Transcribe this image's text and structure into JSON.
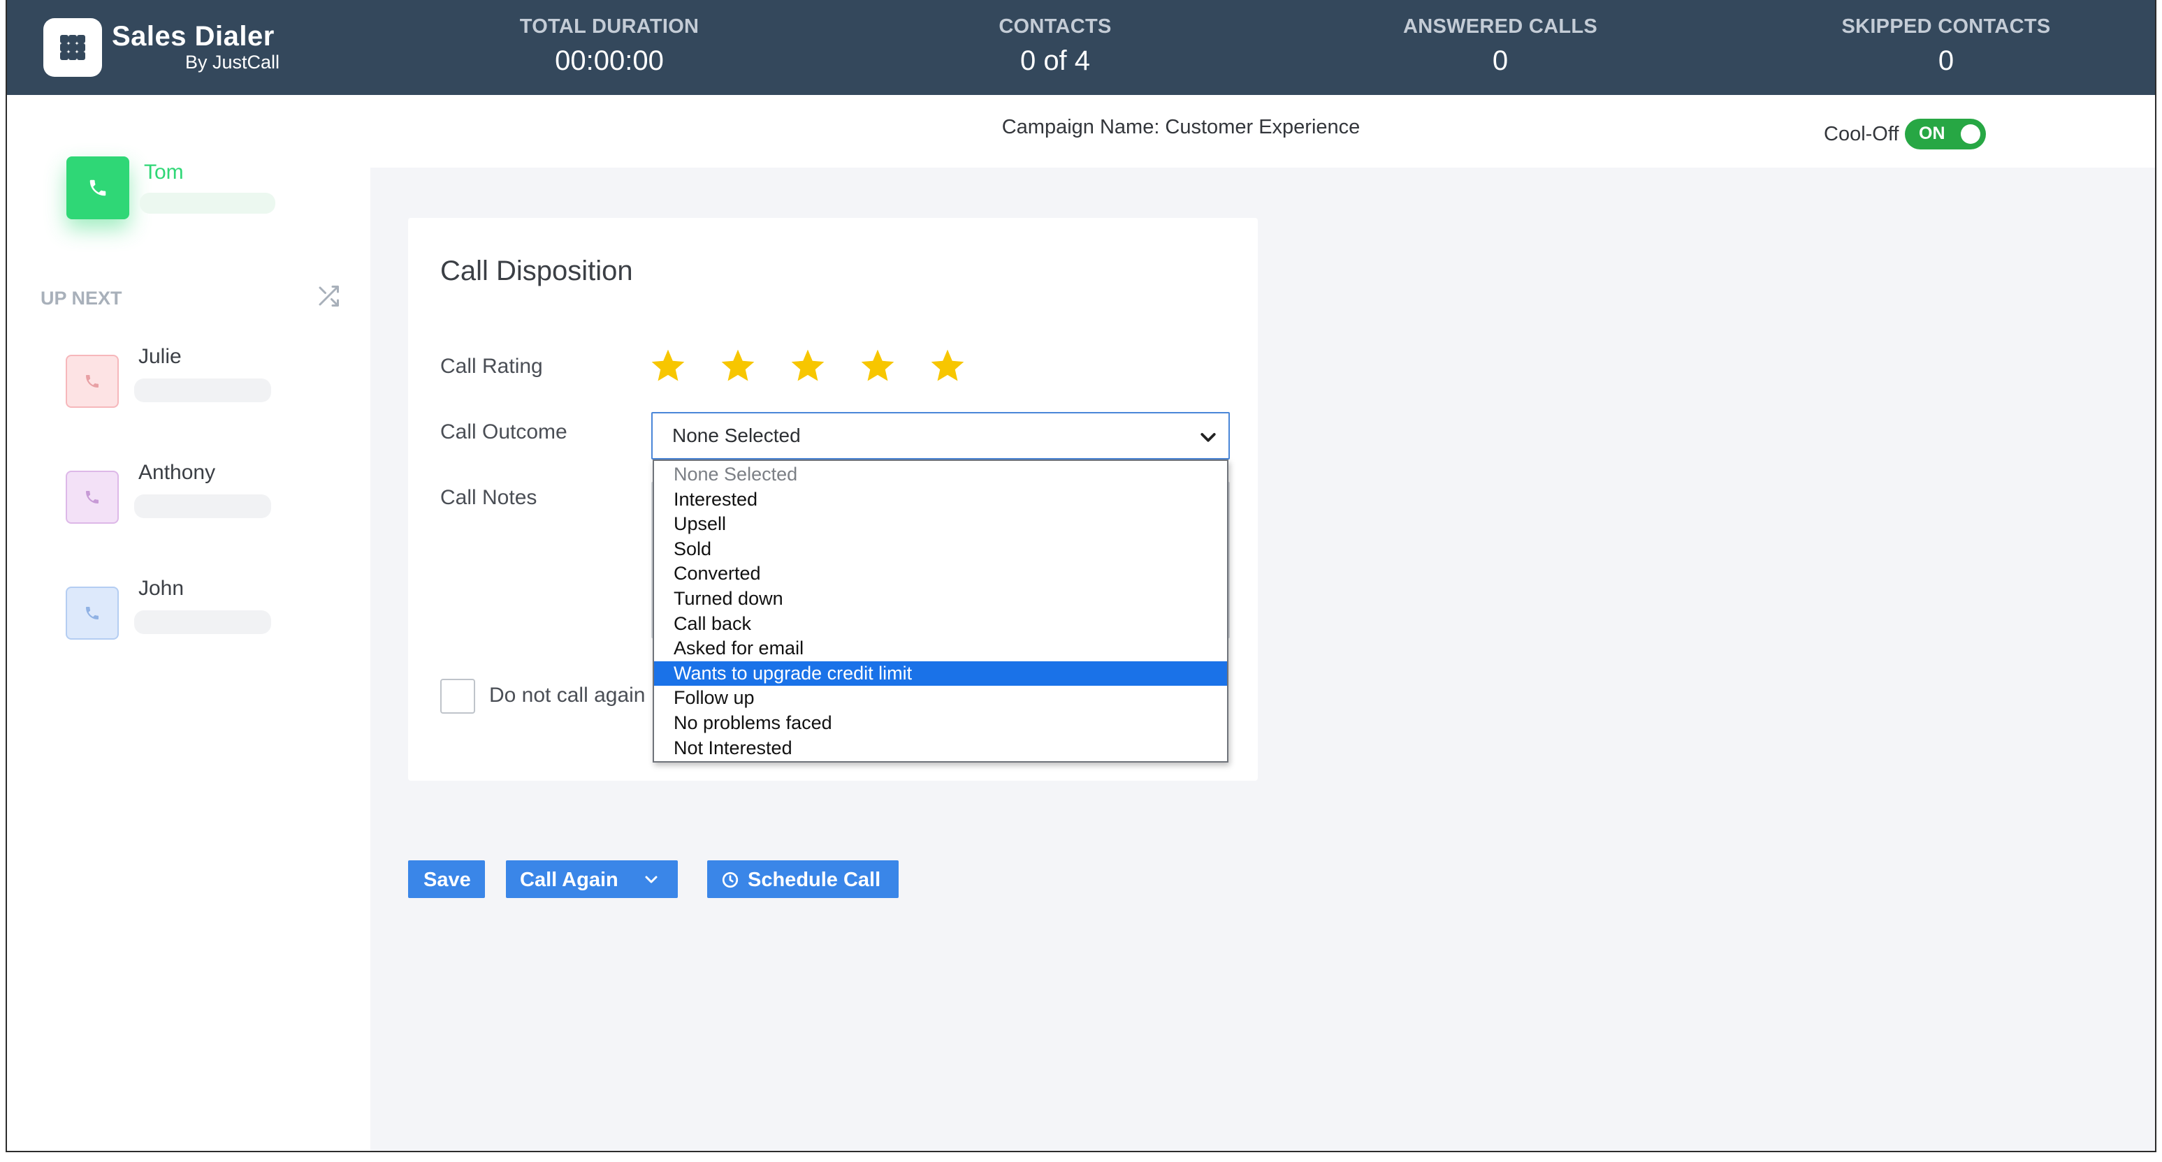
{
  "brand": {
    "name": "Sales Dialer",
    "sub": "By JustCall"
  },
  "stats": [
    {
      "label": "TOTAL DURATION",
      "value": "00:00:00"
    },
    {
      "label": "CONTACTS",
      "value": "0 of 4"
    },
    {
      "label": "ANSWERED CALLS",
      "value": "0"
    },
    {
      "label": "SKIPPED CONTACTS",
      "value": "0"
    }
  ],
  "campaign": {
    "name_text": "Campaign Name: Customer Experience",
    "cooloff_label": "Cool-Off",
    "cooloff_toggle": "ON"
  },
  "sidebar": {
    "current_contact": "Tom",
    "up_next_label": "UP NEXT",
    "queue": [
      {
        "name": "Julie"
      },
      {
        "name": "Anthony"
      },
      {
        "name": "John"
      }
    ]
  },
  "disposition": {
    "title": "Call Disposition",
    "rating_label": "Call Rating",
    "rating_stars": 5,
    "outcome_label": "Call Outcome",
    "outcome_value": "None Selected",
    "outcome_options": [
      "None Selected",
      "Interested",
      "Upsell",
      "Sold",
      "Converted",
      "Turned down",
      "Call back",
      "Asked for email",
      "Wants to upgrade credit limit",
      "Follow up",
      "No problems faced",
      "Not Interested"
    ],
    "highlighted_option": "Wants to upgrade credit limit",
    "notes_label": "Call Notes",
    "do_not_call_label": "Do not call again"
  },
  "buttons": {
    "save": "Save",
    "call_again": "Call Again",
    "schedule_call": "Schedule Call"
  },
  "colors": {
    "topbar": "#34485c",
    "active_green": "#2fd776",
    "primary_blue": "#3a86e8",
    "star_yellow": "#f7c600",
    "toggle_green": "#27a744"
  },
  "icons": {
    "logo": "dialpad-icon",
    "queue_action": "shuffle-icon",
    "avatar": "phone-icon",
    "star": "star-icon",
    "select": "chevron-down-icon",
    "schedule": "clock-icon"
  }
}
